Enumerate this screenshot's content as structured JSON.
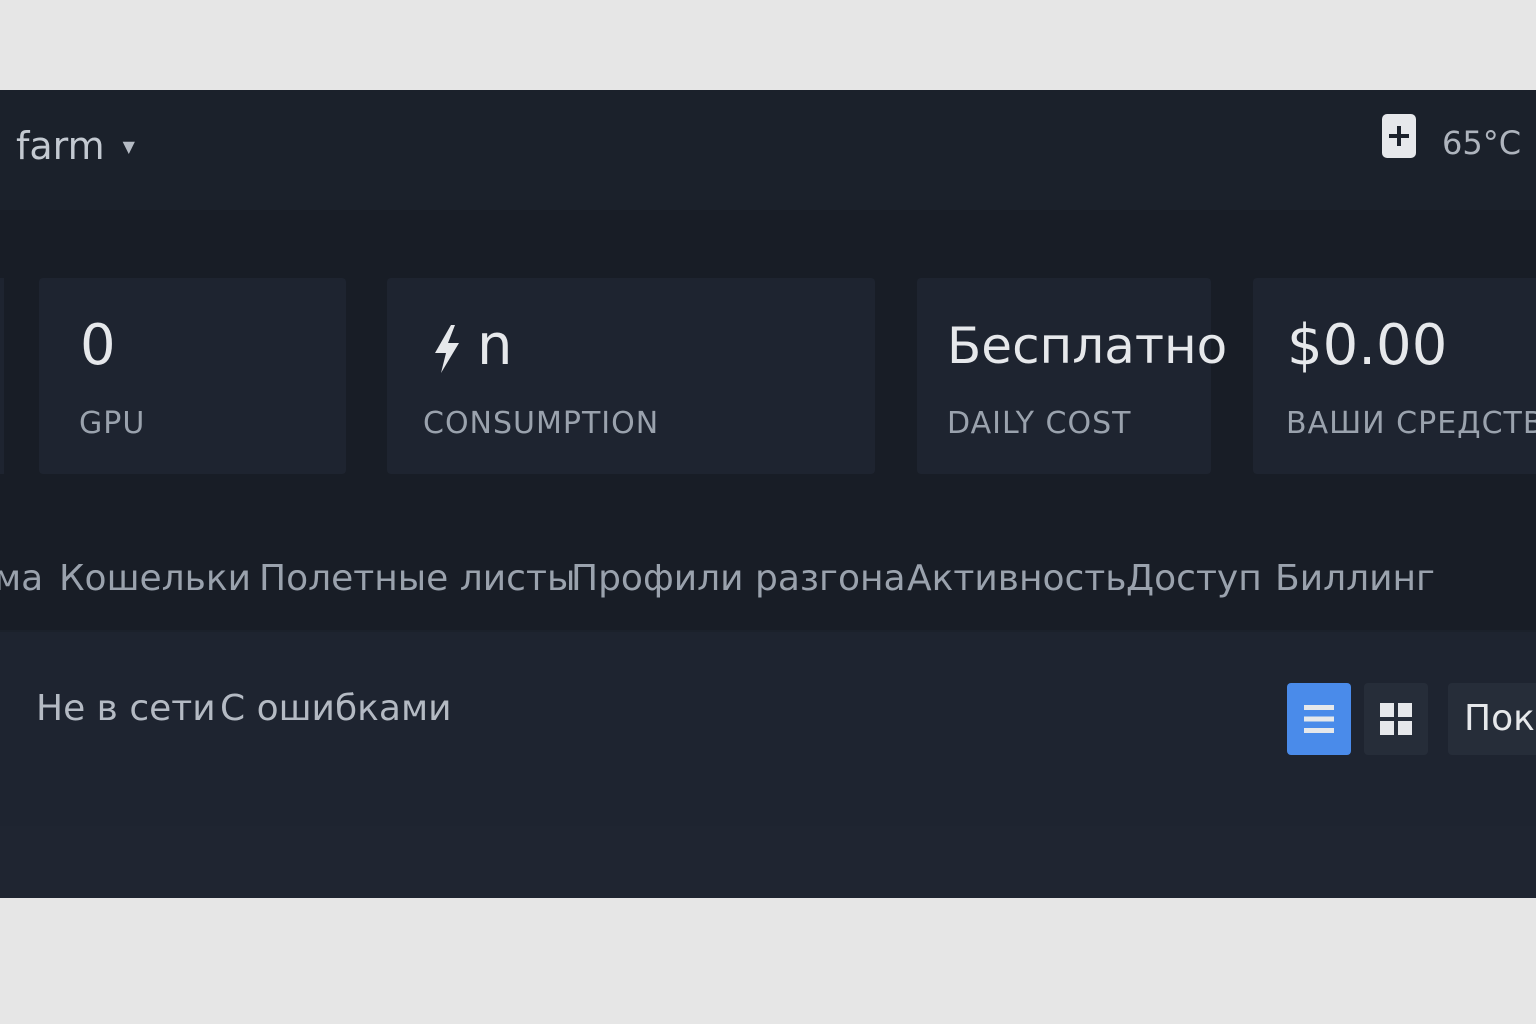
{
  "header": {
    "farm_label": "farm",
    "temperature": "65°C"
  },
  "stats": {
    "gpu": {
      "value": "0",
      "label": "GPU"
    },
    "consumption": {
      "value": "n",
      "label": "CONSUMPTION",
      "icon": "bolt-icon"
    },
    "daily_cost": {
      "value": "Бесплатно",
      "label": "DAILY COST"
    },
    "funds": {
      "value": "$0.00",
      "label": "ВАШИ СРЕДСТВА"
    }
  },
  "nav": {
    "items": [
      {
        "label": "ма"
      },
      {
        "label": "Кошельки"
      },
      {
        "label": "Полетные листы"
      },
      {
        "label": "Профили разгона"
      },
      {
        "label": "Активность"
      },
      {
        "label": "Доступ"
      },
      {
        "label": "Биллинг"
      }
    ]
  },
  "filters": {
    "items": [
      {
        "label": "Не в сети"
      },
      {
        "label": "С ошибками"
      }
    ],
    "show_label": "Пока",
    "active_view": "list",
    "accent_color": "#4a8bea"
  }
}
